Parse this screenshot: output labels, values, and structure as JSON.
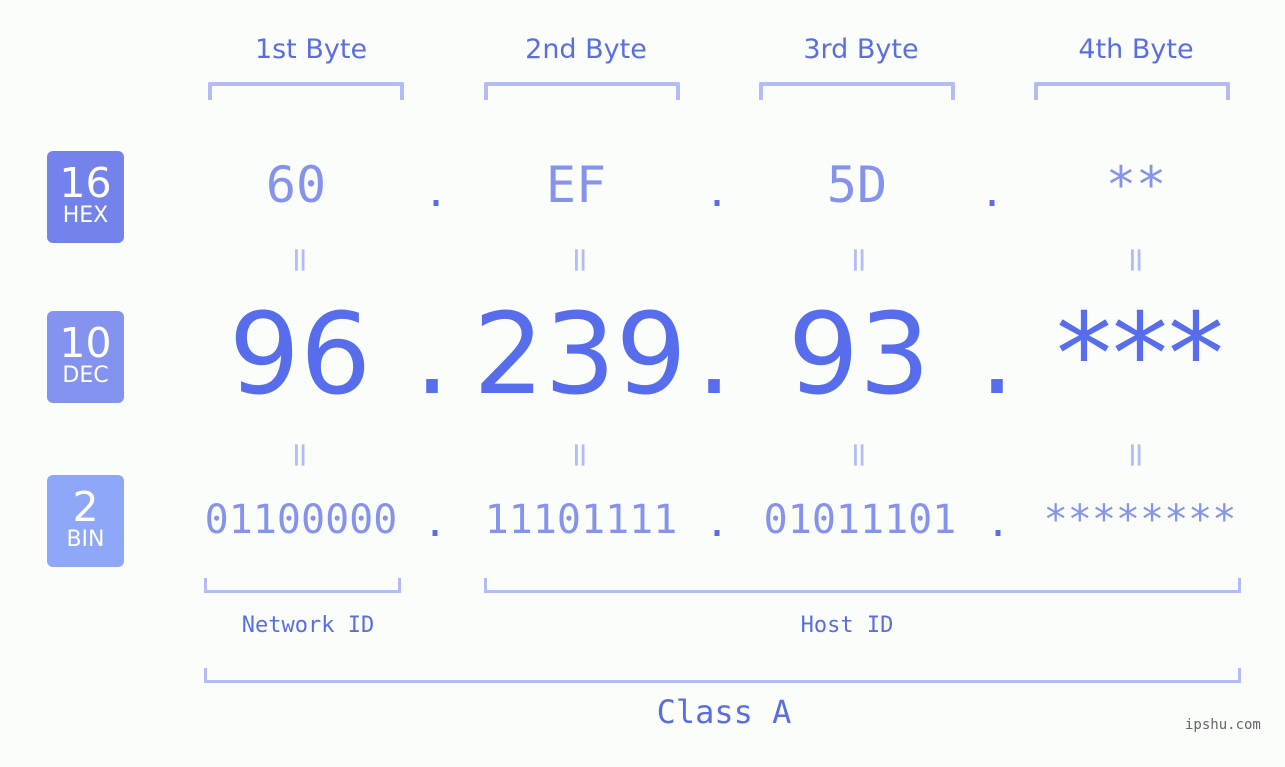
{
  "byte_headers": [
    "1st Byte",
    "2nd Byte",
    "3rd Byte",
    "4th Byte"
  ],
  "badges": [
    {
      "number": "16",
      "label": "HEX",
      "color": "#7383eb"
    },
    {
      "number": "10",
      "label": "DEC",
      "color": "#8593f0"
    },
    {
      "number": "2",
      "label": "BIN",
      "color": "#8fa7f8"
    }
  ],
  "hex": {
    "octets": [
      "60",
      "EF",
      "5D",
      "**"
    ],
    "separator": "."
  },
  "dec": {
    "octets": [
      "96",
      "239",
      "93",
      "***"
    ],
    "separator": "."
  },
  "bin": {
    "octets": [
      "01100000",
      "11101111",
      "01011101",
      "********"
    ],
    "separator": "."
  },
  "equals_sign": "=",
  "network_id_label": "Network ID",
  "host_id_label": "Host ID",
  "class_label": "Class A",
  "watermark": "ipshu.com",
  "colors": {
    "accent": "#586deb",
    "light_accent": "#8593ec",
    "bracket": "#b3bcf5",
    "background": "#fbfdfb"
  }
}
